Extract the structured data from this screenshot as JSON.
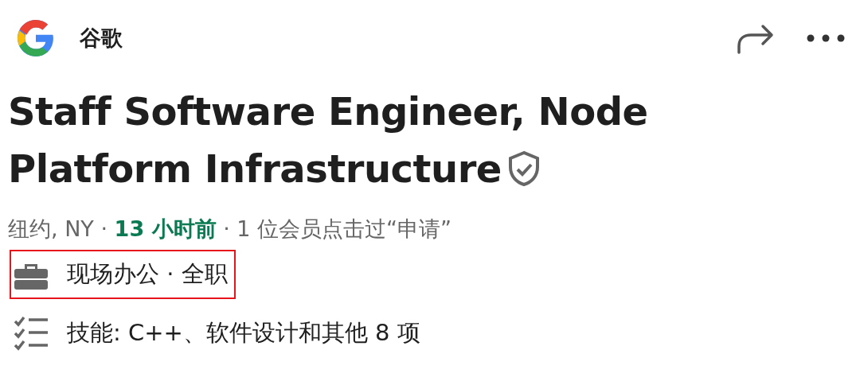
{
  "company": {
    "name": "谷歌"
  },
  "title": "Staff Software Engineer, Node Platform Infrastructure",
  "verified": true,
  "meta": "纽约, NY · **13 小时前** · 1 位会员点击过“申请”",
  "details": [
    {
      "kind": "workplace",
      "text": "现场办公 · 全职",
      "highlighted": true
    },
    {
      "kind": "skills",
      "text": "技能: C++、软件设计和其他 8 项",
      "highlighted": false
    }
  ]
}
